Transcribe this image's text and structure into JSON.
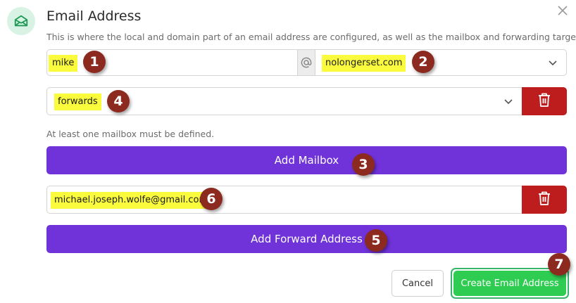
{
  "dialog": {
    "title": "Email Address",
    "description": "This is where the local and domain part of an email address are configured, as well as the mailbox and forwarding targets.",
    "icon": "envelope-icon",
    "close_icon": "close-icon"
  },
  "address": {
    "local_part": "mike",
    "at_symbol": "@",
    "domain": "nolongerset.com"
  },
  "mailbox": {
    "selected": "forwards",
    "hint": "At least one mailbox must be defined.",
    "add_label": "Add Mailbox"
  },
  "forwarding": {
    "address": "michael.joseph.wolfe@gmail.com",
    "add_label": "Add Forward Address"
  },
  "actions": {
    "cancel_label": "Cancel",
    "create_label": "Create Email Address"
  },
  "callouts": [
    "1",
    "2",
    "3",
    "4",
    "5",
    "6",
    "7"
  ],
  "colors": {
    "accent_purple": "#7032d9",
    "delete_red": "#bd1d1d",
    "create_green": "#2fcc52",
    "highlight_yellow": "#fbfb3d",
    "callout_brown": "#8d2a1f"
  }
}
